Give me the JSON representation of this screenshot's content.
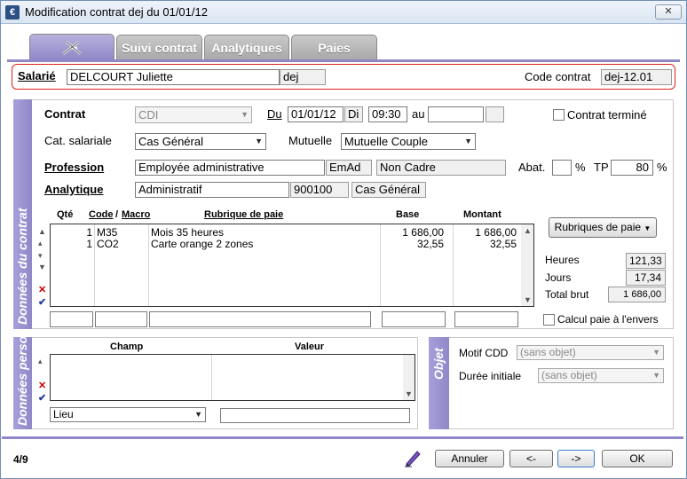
{
  "window": {
    "title": "Modification contrat dej du 01/01/12",
    "close": "✕"
  },
  "tabs": [
    {
      "label": ""
    },
    {
      "label": "Suivi contrat"
    },
    {
      "label": "Analytiques"
    },
    {
      "label": "Paies"
    }
  ],
  "header": {
    "salarie_label": "Salarié",
    "salarie_name": "DELCOURT Juliette",
    "salarie_code": "dej",
    "code_contrat_label": "Code contrat",
    "code_contrat": "dej-12.01"
  },
  "contrat": {
    "section_title": "Données du contrat",
    "contrat_label": "Contrat",
    "contrat_value": "CDI",
    "du_label": "Du",
    "du_date": "01/01/12",
    "du_day": "Di",
    "du_time": "09:30",
    "au_label": "au",
    "au_date": "",
    "au_extra": "",
    "termine_label": "Contrat terminé",
    "cat_label": "Cat. salariale",
    "cat_value": "Cas Général",
    "mutuelle_label": "Mutuelle",
    "mutuelle_value": "Mutuelle Couple",
    "profession_label": "Profession",
    "profession_value": "Employée administrative",
    "profession_code": "EmAd",
    "profession_status": "Non Cadre",
    "abat_label": "Abat.",
    "abat_value": "",
    "pct1": "%",
    "tp_label": "TP",
    "tp_value": "80",
    "pct2": "%",
    "analytique_label": "Analytique",
    "analytique_value": "Administratif",
    "analytique_code": "900100",
    "analytique_cat": "Cas Général"
  },
  "grid": {
    "col_qte": "Qté",
    "col_code": "Code",
    "col_sep": "/",
    "col_macro": "Macro",
    "col_rubrique": "Rubrique de paie",
    "col_base": "Base",
    "col_montant": "Montant",
    "rows": [
      {
        "qte": "1",
        "code": "M35",
        "rubrique": "Mois 35 heures",
        "base": "1 686,00",
        "montant": "1 686,00"
      },
      {
        "qte": "1",
        "code": "CO2",
        "rubrique": "Carte orange 2 zones",
        "base": "32,55",
        "montant": "32,55"
      }
    ]
  },
  "summary": {
    "rubriques_button": "Rubriques de paie",
    "heures_label": "Heures",
    "heures_value": "121,33",
    "jours_label": "Jours",
    "jours_value": "17,34",
    "total_label": "Total brut",
    "total_value": "1 686,00",
    "calcul_label": "Calcul paie à l'envers"
  },
  "perso": {
    "section_title": "Données perso.",
    "col_champ": "Champ",
    "col_valeur": "Valeur",
    "lieu_value": "Lieu",
    "lieu_text": ""
  },
  "objet": {
    "section_title": "Objet",
    "motif_label": "Motif CDD",
    "motif_value": "(sans objet)",
    "duree_label": "Durée initiale",
    "duree_value": "(sans objet)"
  },
  "footer": {
    "page": "4/9",
    "annuler": "Annuler",
    "prev": "<-",
    "next": "->",
    "ok": "OK"
  },
  "colors": {
    "accent": "#8f87c7",
    "highlight": "#e02020"
  }
}
